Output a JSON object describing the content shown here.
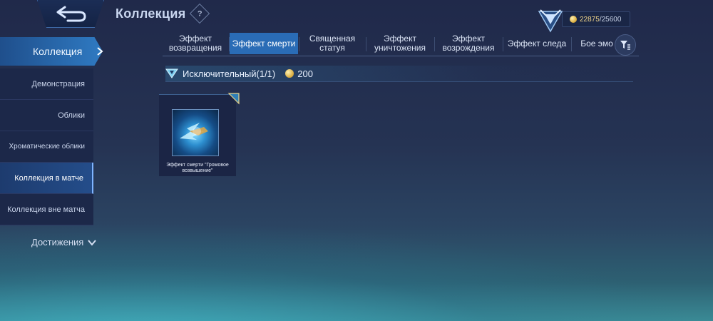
{
  "header": {
    "title": "Коллекция",
    "help_glyph": "?",
    "back_icon": "return-arrow-icon"
  },
  "currency": {
    "value": "22875",
    "max": "/25600",
    "icon": "coin-icon"
  },
  "sidebar": {
    "active_label": "Коллекция",
    "items": [
      {
        "label": "Демонстрация"
      },
      {
        "label": "Облики"
      },
      {
        "label": "Хроматические облики"
      },
      {
        "label": "Коллекция в матче"
      },
      {
        "label": "Коллекция вне матча"
      }
    ],
    "selected_index": 3,
    "achievements_label": "Достижения"
  },
  "tabs": [
    {
      "label": "Эффект возвращения"
    },
    {
      "label": "Эффект смерти"
    },
    {
      "label": "Священная статуя"
    },
    {
      "label": "Эффект уничтожения"
    },
    {
      "label": "Эффект возрождения"
    },
    {
      "label": "Эффект следа"
    },
    {
      "label": "Бое эмо"
    }
  ],
  "active_tab_index": 1,
  "section": {
    "title": "Исключительный(1/1)",
    "points": "200"
  },
  "items": [
    {
      "caption": "Эффект смерти \"Громовое возвышение\""
    }
  ],
  "colors": {
    "accent": "#2a6cb6",
    "gold": "#f0d48a",
    "background": "#20294a"
  }
}
